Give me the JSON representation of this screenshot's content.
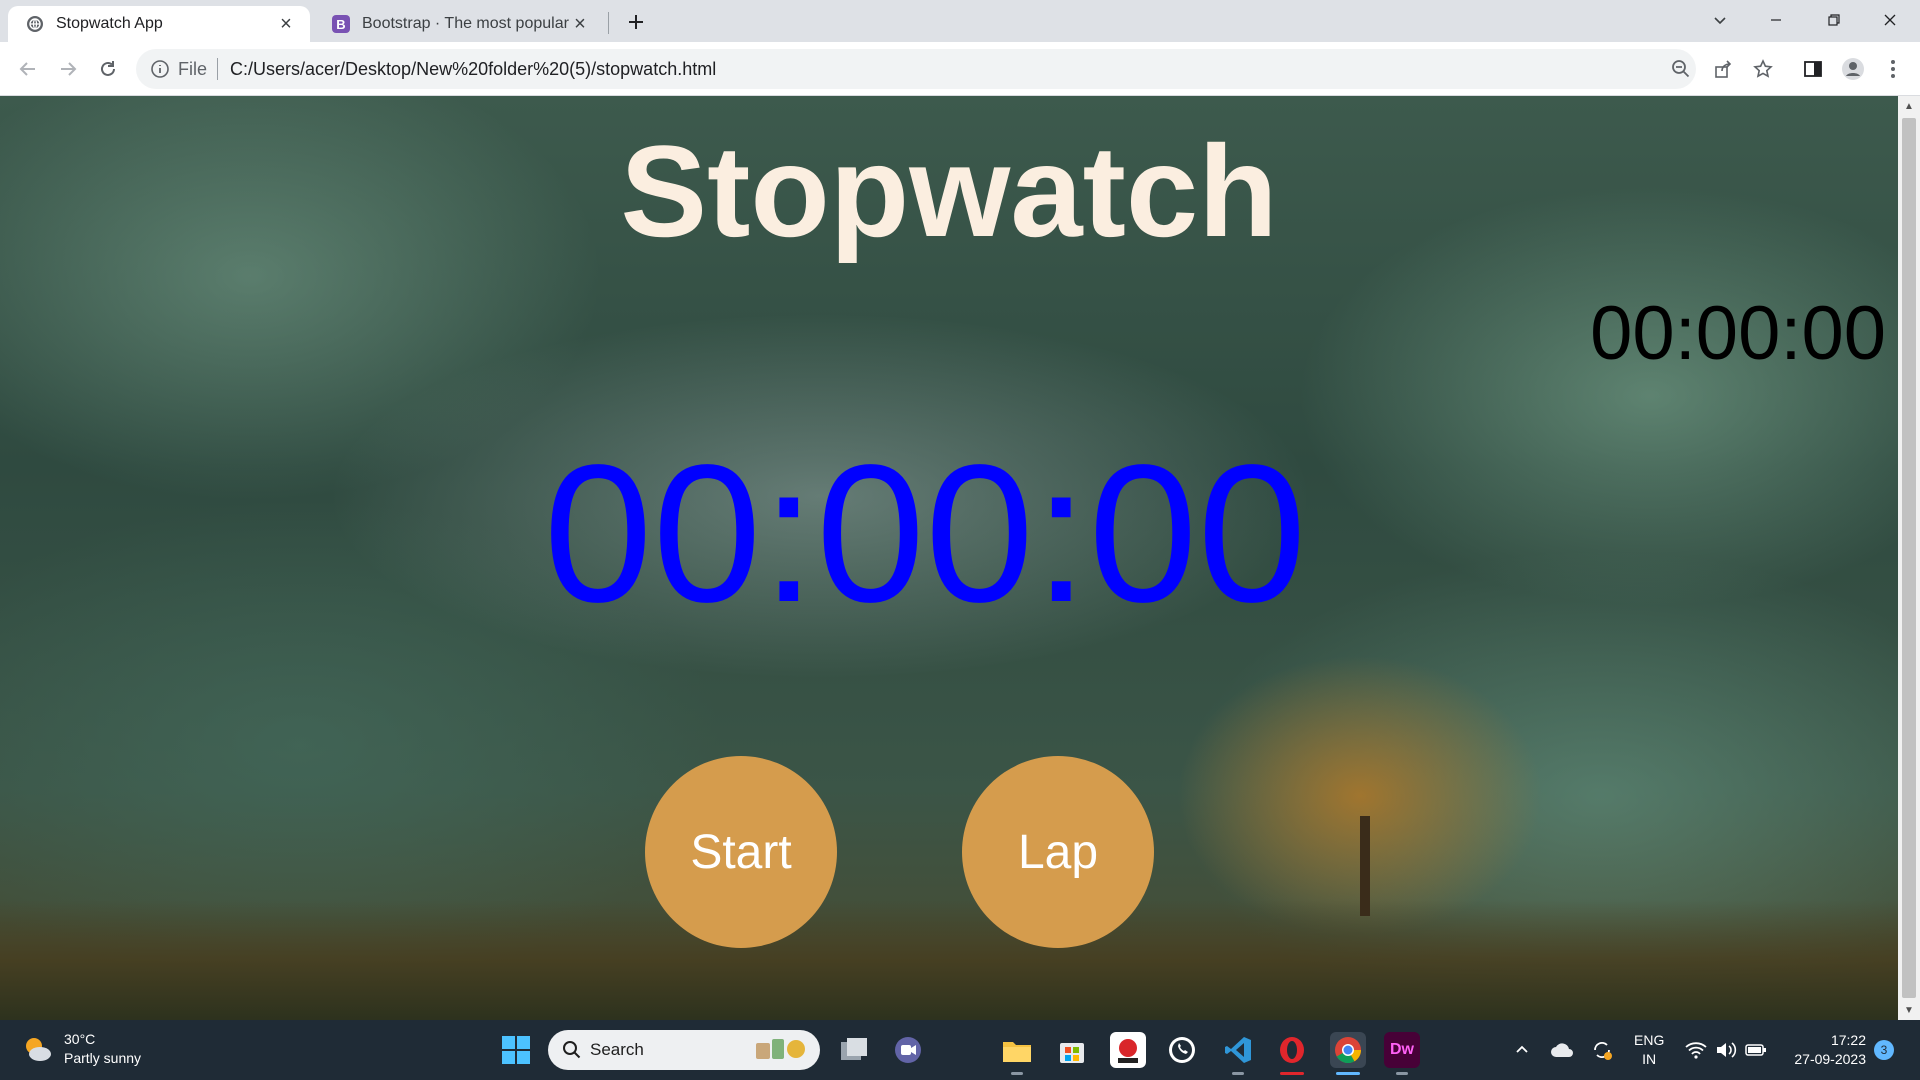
{
  "browser": {
    "tabs": [
      {
        "title": "Stopwatch App",
        "active": true,
        "favicon": "globe-icon"
      },
      {
        "title": "Bootstrap · The most popular HTML",
        "active": false,
        "favicon": "bootstrap-logo-icon",
        "favicon_letter": "B"
      }
    ],
    "address": {
      "scheme_label": "File",
      "url": "C:/Users/acer/Desktop/New%20folder%20(5)/stopwatch.html"
    }
  },
  "page": {
    "title": "Stopwatch",
    "lap_time": "00:00:00",
    "main_time": "00:00:00",
    "start_label": "Start",
    "lap_label": "Lap",
    "colors": {
      "title": "#fbeee0",
      "main_time": "#0000ff",
      "lap_time": "#000000",
      "buttons": "#d59c4d"
    }
  },
  "taskbar": {
    "weather": {
      "temp": "30°C",
      "condition": "Partly sunny"
    },
    "search_placeholder": "Search",
    "apps": [
      "file-explorer",
      "microsoft-store",
      "cs-eagle",
      "whatsapp",
      "vscode",
      "opera",
      "chrome",
      "dreamweaver"
    ],
    "dreamweaver_label": "Dw",
    "language": {
      "line1": "ENG",
      "line2": "IN"
    },
    "clock": {
      "time": "17:22",
      "date": "27-09-2023"
    },
    "notification_count": "3"
  }
}
